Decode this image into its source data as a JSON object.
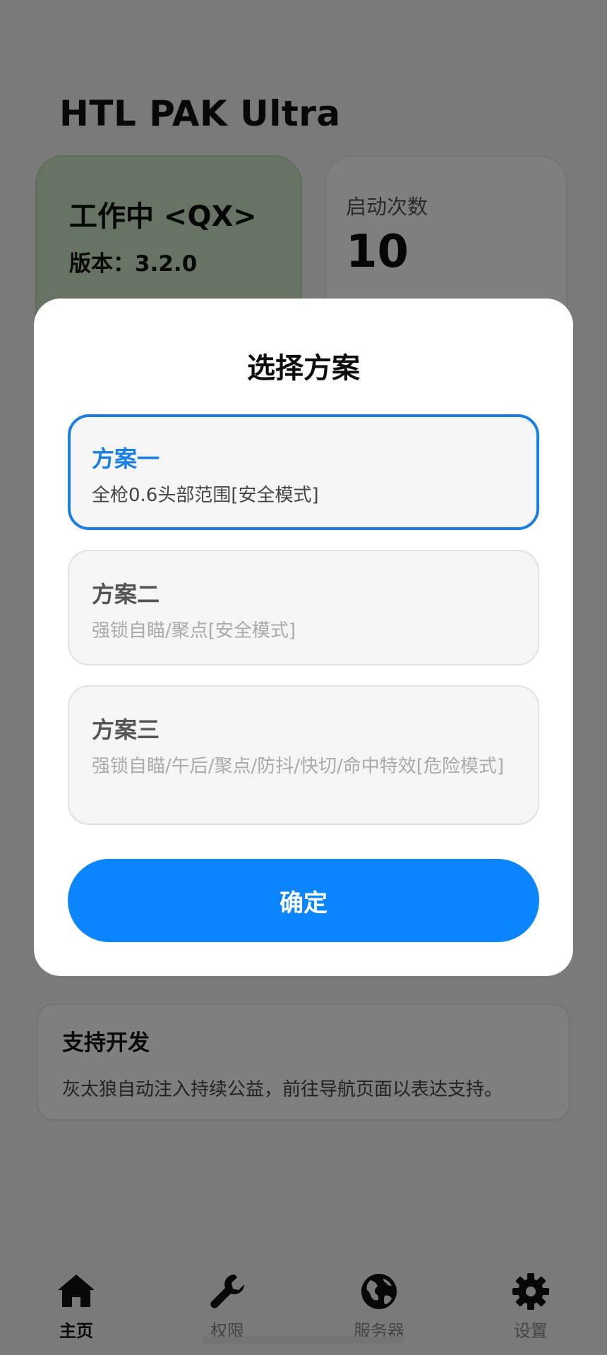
{
  "app": {
    "title": "HTL PAK Ultra"
  },
  "status_card": {
    "status": "工作中 <QX>",
    "version_label": "版本：",
    "version": "3.2.0"
  },
  "launch_card": {
    "label": "启动次数",
    "count": "10"
  },
  "support_card": {
    "title": "支持开发",
    "description": "灰太狼自动注入持续公益，前往导航页面以表达支持。"
  },
  "dialog": {
    "title": "选择方案",
    "options": [
      {
        "title": "方案一",
        "description": "全枪0.6头部范围[安全模式]",
        "selected": true
      },
      {
        "title": "方案二",
        "description": "强锁自瞄/聚点[安全模式]",
        "selected": false
      },
      {
        "title": "方案三",
        "description": "强锁自瞄/午后/聚点/防抖/快切/命中特效[危险模式]",
        "selected": false
      }
    ],
    "confirm_label": "确定"
  },
  "tabbar": {
    "items": [
      {
        "label": "主页",
        "icon": "home-icon",
        "active": true
      },
      {
        "label": "权限",
        "icon": "wrench-icon",
        "active": false
      },
      {
        "label": "服务器",
        "icon": "globe-icon",
        "active": false
      },
      {
        "label": "设置",
        "icon": "gear-icon",
        "active": false
      }
    ]
  },
  "colors": {
    "accent": "#0a84ff",
    "selected_border": "#1a7fe0",
    "status_card_bg": "#cfe9c8",
    "overlay": "rgba(0,0,0,0.5)"
  }
}
